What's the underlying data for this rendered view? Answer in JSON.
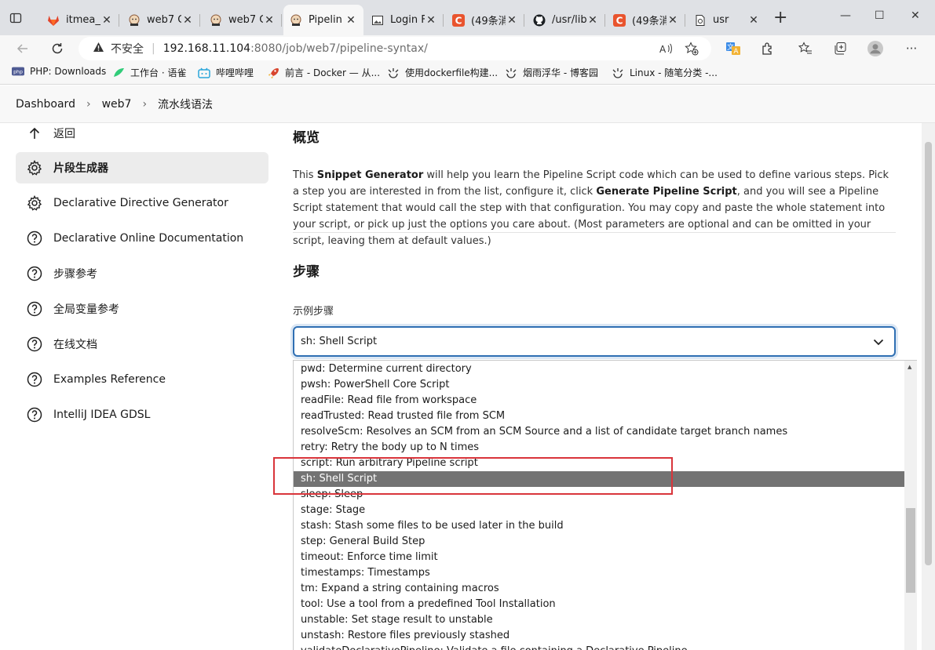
{
  "browser": {
    "tabs": [
      {
        "title": "itmea_",
        "icon": "gitlab-icon"
      },
      {
        "title": "web7 C",
        "icon": "jenkins-icon"
      },
      {
        "title": "web7 C",
        "icon": "jenkins-icon"
      },
      {
        "title": "Pipelin",
        "icon": "jenkins-icon",
        "active": true
      },
      {
        "title": "Login F",
        "icon": "image-icon"
      },
      {
        "title": "(49条消",
        "icon": "csdn-icon"
      },
      {
        "title": "/usr/lib",
        "icon": "github-icon"
      },
      {
        "title": "(49条消",
        "icon": "csdn-icon"
      },
      {
        "title": "usr",
        "icon": "page-icon"
      }
    ],
    "address": {
      "security_label": "不安全",
      "host": "192.168.11.104",
      "path": ":8080/job/web7/pipeline-syntax/"
    },
    "bookmarks": [
      {
        "label": "PHP: Downloads",
        "icon": "php-icon"
      },
      {
        "label": "工作台 · 语雀",
        "icon": "yuque-icon"
      },
      {
        "label": "哔哩哔哩",
        "icon": "bilibili-icon"
      },
      {
        "label": "前言 - Docker — 从...",
        "icon": "rocket-icon"
      },
      {
        "label": "使用dockerfile构建...",
        "icon": "cnblogs-icon"
      },
      {
        "label": "烟雨浮华 - 博客园",
        "icon": "cnblogs-icon"
      },
      {
        "label": "Linux - 随笔分类 -...",
        "icon": "cnblogs-icon"
      }
    ]
  },
  "breadcrumb": [
    "Dashboard",
    "web7",
    "流水线语法"
  ],
  "sidebar": {
    "items": [
      {
        "label": "返回",
        "icon": "arrow-up-icon"
      },
      {
        "label": "片段生成器",
        "icon": "gear-icon",
        "active": true
      },
      {
        "label": "Declarative Directive Generator",
        "icon": "gear-icon"
      },
      {
        "label": "Declarative Online Documentation",
        "icon": "help-icon"
      },
      {
        "label": "步骤参考",
        "icon": "help-icon"
      },
      {
        "label": "全局变量参考",
        "icon": "help-icon"
      },
      {
        "label": "在线文档",
        "icon": "help-icon"
      },
      {
        "label": "Examples Reference",
        "icon": "help-icon"
      },
      {
        "label": "IntelliJ IDEA GDSL",
        "icon": "help-icon"
      }
    ]
  },
  "main": {
    "overview_title": "概览",
    "intro": {
      "p1": "This ",
      "b1": "Snippet Generator",
      "p2": " will help you learn the Pipeline Script code which can be used to define various steps. Pick a step you are interested in from the list, configure it, click ",
      "b2": "Generate Pipeline Script",
      "p3": ", and you will see a Pipeline Script statement that would call the step with that configuration. You may copy and paste the whole statement into your script, or pick up just the options you care about. (Most parameters are optional and can be omitted in your script, leaving them at default values.)"
    },
    "steps_title": "步骤",
    "sample_step_label": "示例步骤",
    "selected_step": "sh: Shell Script",
    "options": [
      "pwd: Determine current directory",
      "pwsh: PowerShell Core Script",
      "readFile: Read file from workspace",
      "readTrusted: Read trusted file from SCM",
      "resolveScm: Resolves an SCM from an SCM Source and a list of candidate target branch names",
      "retry: Retry the body up to N times",
      "script: Run arbitrary Pipeline script",
      "sh: Shell Script",
      "sleep: Sleep",
      "stage: Stage",
      "stash: Stash some files to be used later in the build",
      "step: General Build Step",
      "timeout: Enforce time limit",
      "timestamps: Timestamps",
      "tm: Expand a string containing macros",
      "tool: Use a tool from a predefined Tool Installation",
      "unstable: Set stage result to unstable",
      "unstash: Restore files previously stashed",
      "validateDeclarativePipeline: Validate a file containing a Declarative Pipeline"
    ],
    "selected_index": 7
  },
  "colors": {
    "accent": "#2f6fb3",
    "selected_option_bg": "#737373",
    "annotation": "#d9353b"
  }
}
